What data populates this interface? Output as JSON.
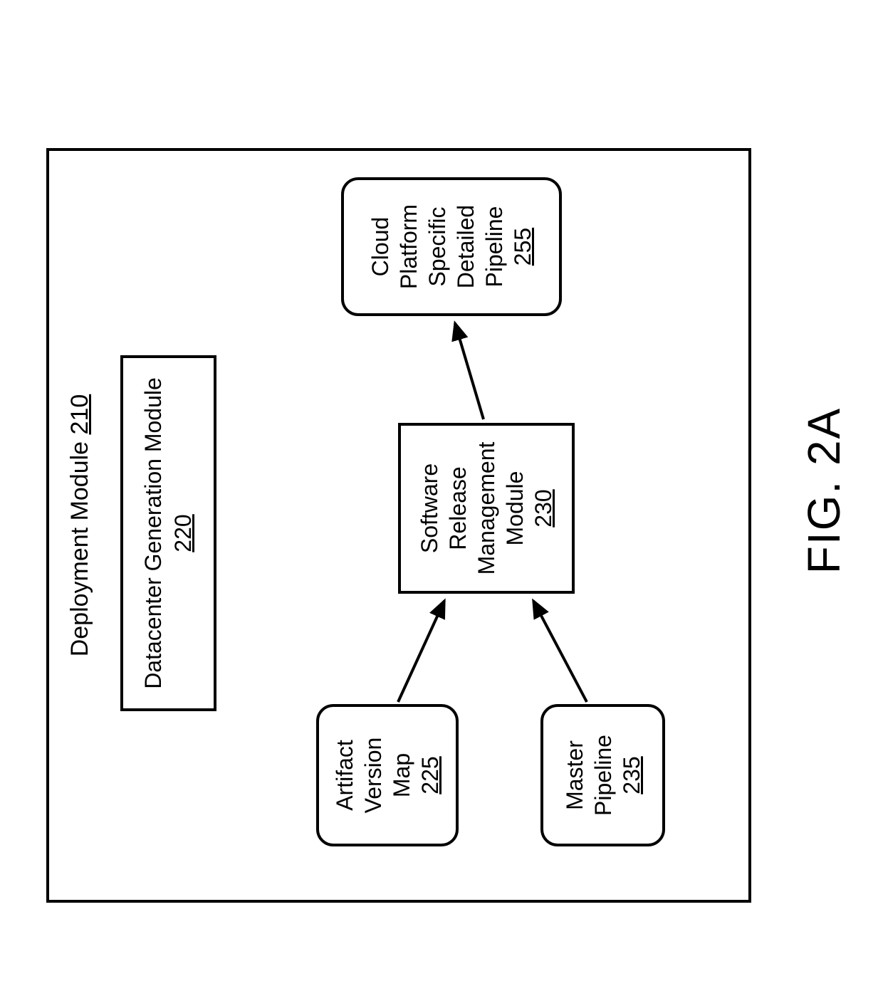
{
  "figure_label": "FIG. 2A",
  "outer": {
    "title": "Deployment Module",
    "num": "210"
  },
  "datacenter": {
    "title": "Datacenter Generation Module",
    "num": "220"
  },
  "avm": {
    "l1": "Artifact",
    "l2": "Version Map",
    "num": "225"
  },
  "mp": {
    "l1": "Master",
    "l2": "Pipeline",
    "num": "235"
  },
  "srm": {
    "l1": "Software",
    "l2": "Release",
    "l3": "Management",
    "l4": "Module",
    "num": "230"
  },
  "cpp": {
    "l1": "Cloud",
    "l2": "Platform",
    "l3": "Specific",
    "l4": "Detailed",
    "l5": "Pipeline",
    "num": "255"
  }
}
